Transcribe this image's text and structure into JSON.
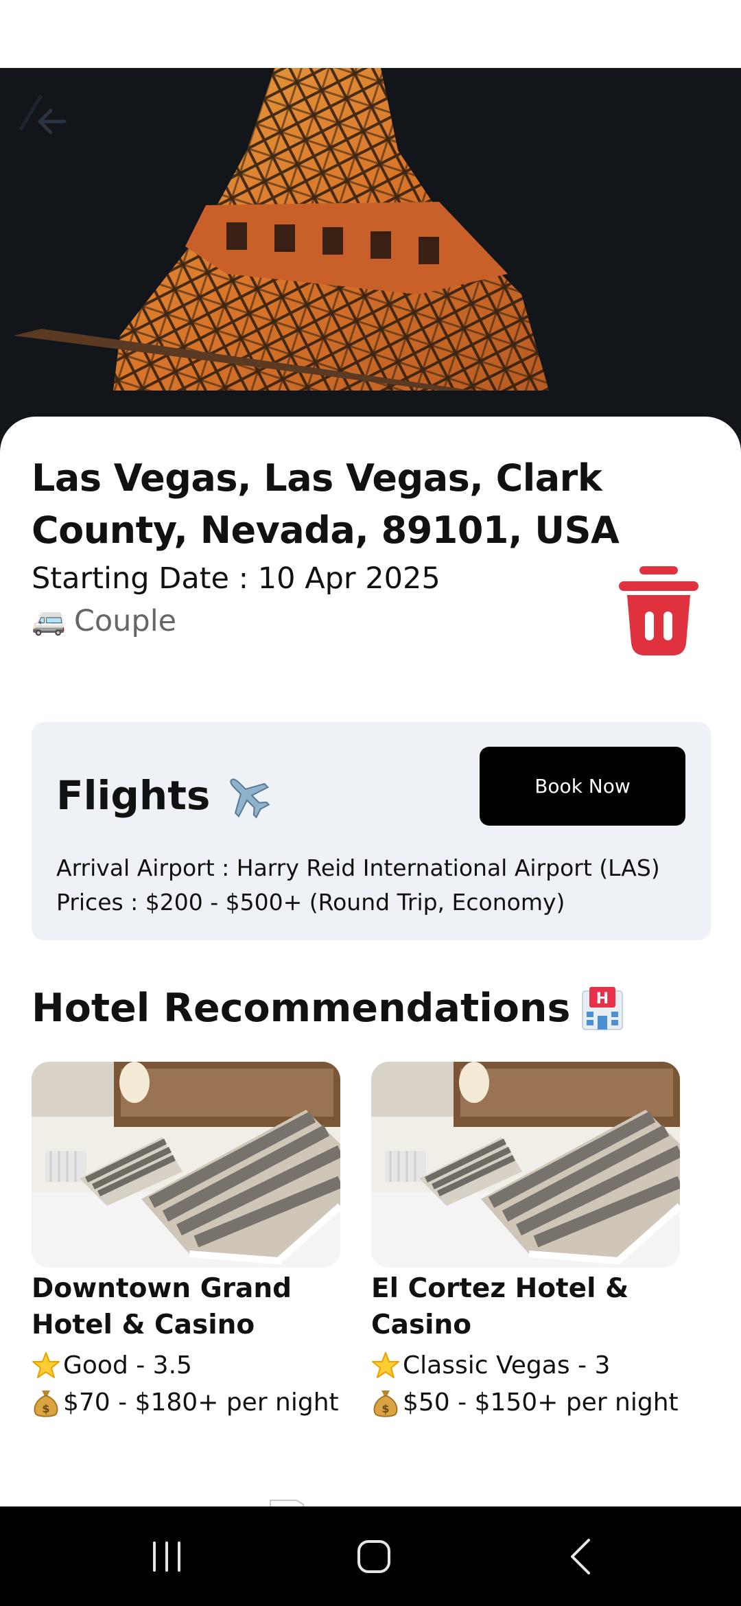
{
  "destination": {
    "title": "Las Vegas, Las Vegas, Clark County, Nevada, 89101, USA",
    "starting_date": "Starting Date : 10 Apr 2025",
    "travelers_emoji": "🚐",
    "travelers": "Couple"
  },
  "flights": {
    "title": "Flights",
    "icon": "airplane-icon",
    "book_label": "Book Now",
    "arrival": "Arrival Airport : Harry Reid International Airport (LAS)",
    "prices": "Prices : $200 - $500+ (Round Trip, Economy)"
  },
  "hotels": {
    "heading": "Hotel Recommendations",
    "icon": "hotel-icon",
    "items": [
      {
        "name": "Downtown Grand Hotel & Casino",
        "rating": "Good - 3.5",
        "price": "$70 - $180+ per night"
      },
      {
        "name": "El Cortez Hotel & Casino",
        "rating": "Classic Vegas - 3",
        "price": "$50 - $150+ per night"
      }
    ]
  },
  "icons": {
    "back": "arrow-left-icon",
    "delete": "trash-icon",
    "rating": "star-icon",
    "price": "money-bag-icon",
    "nav": [
      "recents-icon",
      "home-icon",
      "back-chevron-icon"
    ]
  },
  "colors": {
    "delete": "#e0313f",
    "card_background": "#eef2f6",
    "button": "#000000",
    "nav_bar": "#000000"
  }
}
